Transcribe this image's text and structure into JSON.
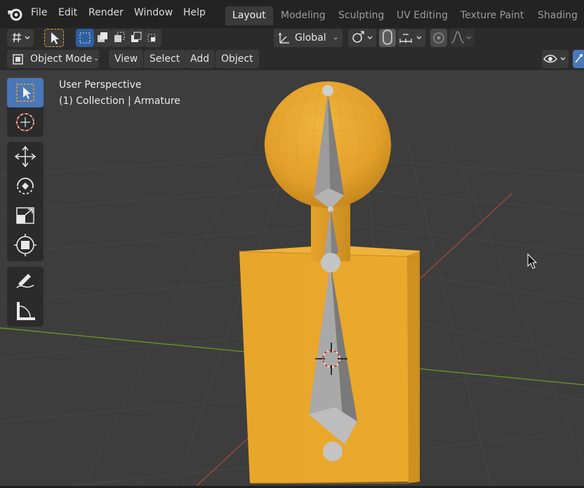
{
  "menubar": {
    "menus": [
      "File",
      "Edit",
      "Render",
      "Window",
      "Help"
    ],
    "workspaces": [
      {
        "label": "Layout",
        "active": true
      },
      {
        "label": "Modeling",
        "active": false
      },
      {
        "label": "Sculpting",
        "active": false
      },
      {
        "label": "UV Editing",
        "active": false
      },
      {
        "label": "Texture Paint",
        "active": false
      },
      {
        "label": "Shading",
        "active": false
      }
    ]
  },
  "toolsettings": {
    "transform_orientation": "Global"
  },
  "header": {
    "mode": "Object Mode",
    "menus": [
      "View",
      "Select",
      "Add",
      "Object"
    ]
  },
  "viewport": {
    "perspective_label": "User Perspective",
    "collection_label": "(1) Collection | Armature"
  },
  "colors": {
    "accent": "#4a77b8",
    "object_orange": "#e8a62a",
    "bone_gray": "#9a9a9a",
    "x_axis": "#a0483c",
    "y_axis": "#6a8f2a"
  },
  "icons": {
    "logo": "blender-logo-icon",
    "tools": [
      "select-box-icon",
      "cursor-icon",
      "move-icon",
      "rotate-icon",
      "scale-icon",
      "transform-icon",
      "annotate-icon",
      "measure-icon"
    ]
  }
}
